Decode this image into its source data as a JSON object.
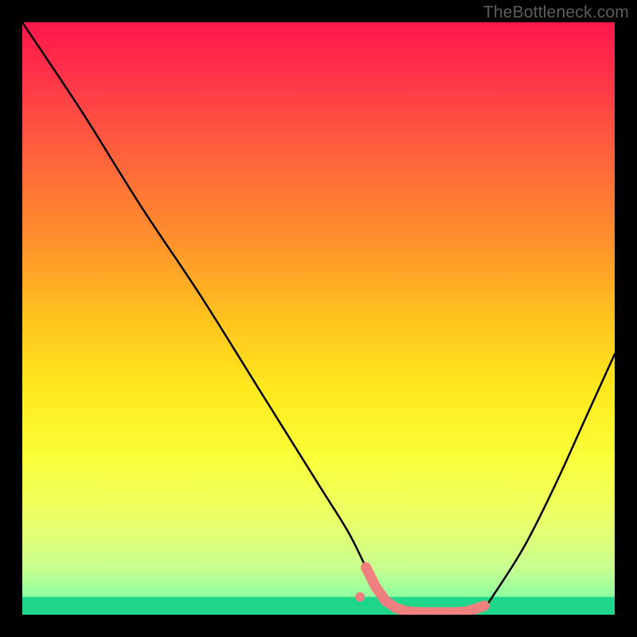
{
  "watermark": "TheBottleneck.com",
  "chart_data": {
    "type": "line",
    "title": "",
    "xlabel": "",
    "ylabel": "",
    "xlim": [
      0,
      100
    ],
    "ylim": [
      0,
      100
    ],
    "grid": false,
    "series": [
      {
        "name": "curve",
        "x": [
          0,
          10,
          20,
          30,
          40,
          50,
          55,
          58,
          60,
          62,
          65,
          70,
          75,
          78,
          80,
          85,
          90,
          95,
          100
        ],
        "values": [
          100,
          85,
          69,
          54,
          38,
          22,
          14,
          8,
          4,
          1.5,
          0.5,
          0.3,
          0.5,
          1.5,
          4,
          12,
          22,
          33,
          44
        ]
      }
    ],
    "marker_band": {
      "x_start": 58,
      "x_end": 78,
      "y": 1
    },
    "point": {
      "x": 57,
      "y": 3
    },
    "green_strip_height": 3,
    "gradient_stops": [
      {
        "pos": 0.0,
        "color": "#ff174a"
      },
      {
        "pos": 0.08,
        "color": "#ff2f4a"
      },
      {
        "pos": 0.2,
        "color": "#ff5a3f"
      },
      {
        "pos": 0.35,
        "color": "#ff8a2e"
      },
      {
        "pos": 0.5,
        "color": "#ffc31e"
      },
      {
        "pos": 0.62,
        "color": "#ffe91d"
      },
      {
        "pos": 0.74,
        "color": "#f9ff3a"
      },
      {
        "pos": 0.84,
        "color": "#eaff6a"
      },
      {
        "pos": 0.92,
        "color": "#c9ff8f"
      },
      {
        "pos": 0.97,
        "color": "#8effa0"
      },
      {
        "pos": 1.0,
        "color": "#2dffae"
      }
    ]
  }
}
